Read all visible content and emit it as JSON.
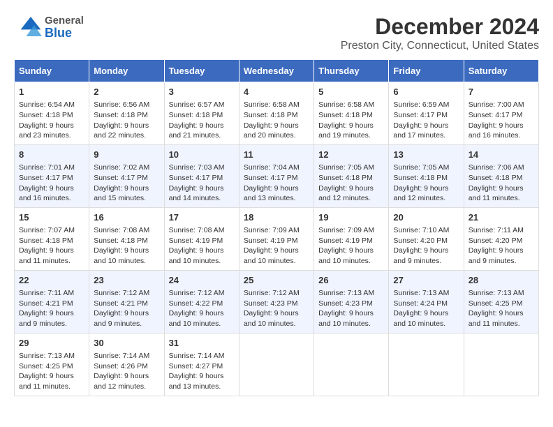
{
  "header": {
    "title": "December 2024",
    "subtitle": "Preston City, Connecticut, United States",
    "logo_general": "General",
    "logo_blue": "Blue"
  },
  "days_of_week": [
    "Sunday",
    "Monday",
    "Tuesday",
    "Wednesday",
    "Thursday",
    "Friday",
    "Saturday"
  ],
  "weeks": [
    [
      {
        "day": "1",
        "lines": [
          "Sunrise: 6:54 AM",
          "Sunset: 4:18 PM",
          "Daylight: 9 hours",
          "and 23 minutes."
        ]
      },
      {
        "day": "2",
        "lines": [
          "Sunrise: 6:56 AM",
          "Sunset: 4:18 PM",
          "Daylight: 9 hours",
          "and 22 minutes."
        ]
      },
      {
        "day": "3",
        "lines": [
          "Sunrise: 6:57 AM",
          "Sunset: 4:18 PM",
          "Daylight: 9 hours",
          "and 21 minutes."
        ]
      },
      {
        "day": "4",
        "lines": [
          "Sunrise: 6:58 AM",
          "Sunset: 4:18 PM",
          "Daylight: 9 hours",
          "and 20 minutes."
        ]
      },
      {
        "day": "5",
        "lines": [
          "Sunrise: 6:58 AM",
          "Sunset: 4:18 PM",
          "Daylight: 9 hours",
          "and 19 minutes."
        ]
      },
      {
        "day": "6",
        "lines": [
          "Sunrise: 6:59 AM",
          "Sunset: 4:17 PM",
          "Daylight: 9 hours",
          "and 17 minutes."
        ]
      },
      {
        "day": "7",
        "lines": [
          "Sunrise: 7:00 AM",
          "Sunset: 4:17 PM",
          "Daylight: 9 hours",
          "and 16 minutes."
        ]
      }
    ],
    [
      {
        "day": "8",
        "lines": [
          "Sunrise: 7:01 AM",
          "Sunset: 4:17 PM",
          "Daylight: 9 hours",
          "and 16 minutes."
        ]
      },
      {
        "day": "9",
        "lines": [
          "Sunrise: 7:02 AM",
          "Sunset: 4:17 PM",
          "Daylight: 9 hours",
          "and 15 minutes."
        ]
      },
      {
        "day": "10",
        "lines": [
          "Sunrise: 7:03 AM",
          "Sunset: 4:17 PM",
          "Daylight: 9 hours",
          "and 14 minutes."
        ]
      },
      {
        "day": "11",
        "lines": [
          "Sunrise: 7:04 AM",
          "Sunset: 4:17 PM",
          "Daylight: 9 hours",
          "and 13 minutes."
        ]
      },
      {
        "day": "12",
        "lines": [
          "Sunrise: 7:05 AM",
          "Sunset: 4:18 PM",
          "Daylight: 9 hours",
          "and 12 minutes."
        ]
      },
      {
        "day": "13",
        "lines": [
          "Sunrise: 7:05 AM",
          "Sunset: 4:18 PM",
          "Daylight: 9 hours",
          "and 12 minutes."
        ]
      },
      {
        "day": "14",
        "lines": [
          "Sunrise: 7:06 AM",
          "Sunset: 4:18 PM",
          "Daylight: 9 hours",
          "and 11 minutes."
        ]
      }
    ],
    [
      {
        "day": "15",
        "lines": [
          "Sunrise: 7:07 AM",
          "Sunset: 4:18 PM",
          "Daylight: 9 hours",
          "and 11 minutes."
        ]
      },
      {
        "day": "16",
        "lines": [
          "Sunrise: 7:08 AM",
          "Sunset: 4:18 PM",
          "Daylight: 9 hours",
          "and 10 minutes."
        ]
      },
      {
        "day": "17",
        "lines": [
          "Sunrise: 7:08 AM",
          "Sunset: 4:19 PM",
          "Daylight: 9 hours",
          "and 10 minutes."
        ]
      },
      {
        "day": "18",
        "lines": [
          "Sunrise: 7:09 AM",
          "Sunset: 4:19 PM",
          "Daylight: 9 hours",
          "and 10 minutes."
        ]
      },
      {
        "day": "19",
        "lines": [
          "Sunrise: 7:09 AM",
          "Sunset: 4:19 PM",
          "Daylight: 9 hours",
          "and 10 minutes."
        ]
      },
      {
        "day": "20",
        "lines": [
          "Sunrise: 7:10 AM",
          "Sunset: 4:20 PM",
          "Daylight: 9 hours",
          "and 9 minutes."
        ]
      },
      {
        "day": "21",
        "lines": [
          "Sunrise: 7:11 AM",
          "Sunset: 4:20 PM",
          "Daylight: 9 hours",
          "and 9 minutes."
        ]
      }
    ],
    [
      {
        "day": "22",
        "lines": [
          "Sunrise: 7:11 AM",
          "Sunset: 4:21 PM",
          "Daylight: 9 hours",
          "and 9 minutes."
        ]
      },
      {
        "day": "23",
        "lines": [
          "Sunrise: 7:12 AM",
          "Sunset: 4:21 PM",
          "Daylight: 9 hours",
          "and 9 minutes."
        ]
      },
      {
        "day": "24",
        "lines": [
          "Sunrise: 7:12 AM",
          "Sunset: 4:22 PM",
          "Daylight: 9 hours",
          "and 10 minutes."
        ]
      },
      {
        "day": "25",
        "lines": [
          "Sunrise: 7:12 AM",
          "Sunset: 4:23 PM",
          "Daylight: 9 hours",
          "and 10 minutes."
        ]
      },
      {
        "day": "26",
        "lines": [
          "Sunrise: 7:13 AM",
          "Sunset: 4:23 PM",
          "Daylight: 9 hours",
          "and 10 minutes."
        ]
      },
      {
        "day": "27",
        "lines": [
          "Sunrise: 7:13 AM",
          "Sunset: 4:24 PM",
          "Daylight: 9 hours",
          "and 10 minutes."
        ]
      },
      {
        "day": "28",
        "lines": [
          "Sunrise: 7:13 AM",
          "Sunset: 4:25 PM",
          "Daylight: 9 hours",
          "and 11 minutes."
        ]
      }
    ],
    [
      {
        "day": "29",
        "lines": [
          "Sunrise: 7:13 AM",
          "Sunset: 4:25 PM",
          "Daylight: 9 hours",
          "and 11 minutes."
        ]
      },
      {
        "day": "30",
        "lines": [
          "Sunrise: 7:14 AM",
          "Sunset: 4:26 PM",
          "Daylight: 9 hours",
          "and 12 minutes."
        ]
      },
      {
        "day": "31",
        "lines": [
          "Sunrise: 7:14 AM",
          "Sunset: 4:27 PM",
          "Daylight: 9 hours",
          "and 13 minutes."
        ]
      },
      null,
      null,
      null,
      null
    ]
  ]
}
